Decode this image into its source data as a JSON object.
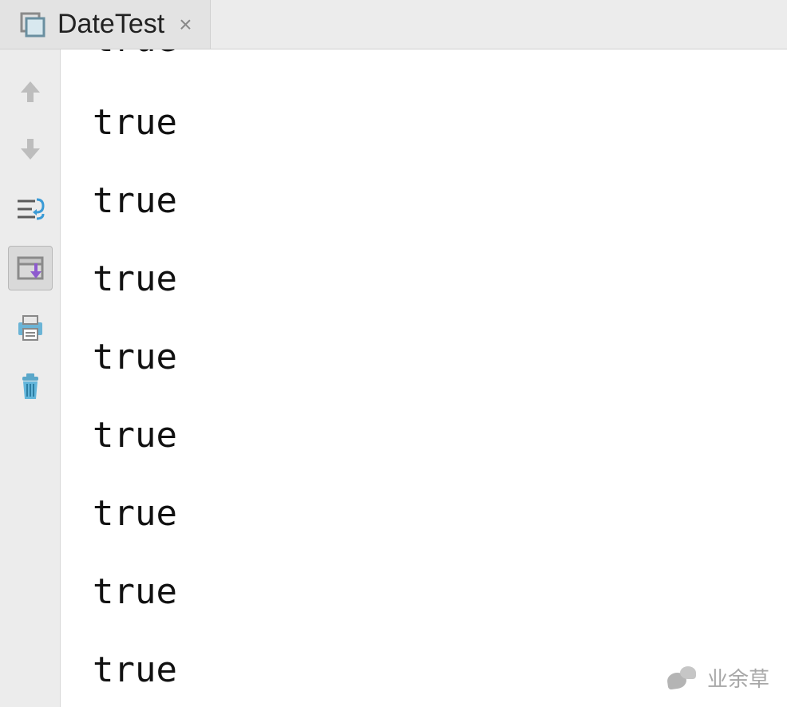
{
  "tab": {
    "label": "DateTest",
    "close_glyph": "×"
  },
  "toolbar": {
    "items": [
      {
        "name": "arrow-up-icon"
      },
      {
        "name": "arrow-down-icon"
      },
      {
        "name": "soft-wrap-icon"
      },
      {
        "name": "scroll-to-end-icon"
      },
      {
        "name": "print-icon"
      },
      {
        "name": "trash-icon"
      }
    ]
  },
  "console": {
    "lines": [
      "true",
      "true",
      "true",
      "true",
      "true",
      "true",
      "true",
      "true",
      "true"
    ]
  },
  "watermark": {
    "text": "业余草"
  }
}
